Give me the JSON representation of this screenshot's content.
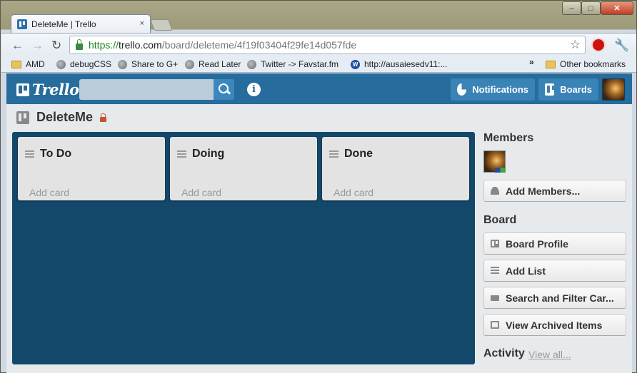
{
  "browser": {
    "tab_title": "DeleteMe | Trello",
    "tab_close": "×",
    "window_controls": {
      "minimize": "–",
      "maximize": "□",
      "close": "✕"
    },
    "nav": {
      "back": "←",
      "forward": "→",
      "reload": "↻"
    },
    "address": {
      "scheme": "https://",
      "host": "trello.com",
      "path": "/board/deleteme/4f19f03404f29fe14d057fde"
    },
    "star": "☆",
    "stop_extension": "STOP",
    "wrench": "🔧",
    "bookmarks": [
      {
        "label": "AMD",
        "icon": "folder-icon"
      },
      {
        "label": "debugCSS",
        "icon": "globe-icon"
      },
      {
        "label": "Share to G+",
        "icon": "globe-icon"
      },
      {
        "label": "Read Later",
        "icon": "globe-icon"
      },
      {
        "label": "Twitter -> Favstar.fm",
        "icon": "globe-icon"
      },
      {
        "label": "http://ausaiesedv11:...",
        "icon": "w-icon"
      }
    ],
    "bookmarks_overflow": "»",
    "other_bookmarks": "Other bookmarks"
  },
  "header": {
    "logo_text": "Trello",
    "search_placeholder": "",
    "info": "i",
    "notifications_label": "Notifications",
    "boards_label": "Boards",
    "accent": "#266c9c"
  },
  "board": {
    "title": "DeleteMe",
    "canvas_color": "#14486a",
    "lists": [
      {
        "title": "To Do",
        "add_card": "Add card"
      },
      {
        "title": "Doing",
        "add_card": "Add card"
      },
      {
        "title": "Done",
        "add_card": "Add card"
      }
    ]
  },
  "sidebar": {
    "members_heading": "Members",
    "add_members": "Add Members...",
    "board_heading": "Board",
    "board_profile": "Board Profile",
    "add_list": "Add List",
    "search_filter": "Search and Filter Car...",
    "view_archived": "View Archived Items",
    "activity_heading": "Activity",
    "view_all": "View all..."
  }
}
